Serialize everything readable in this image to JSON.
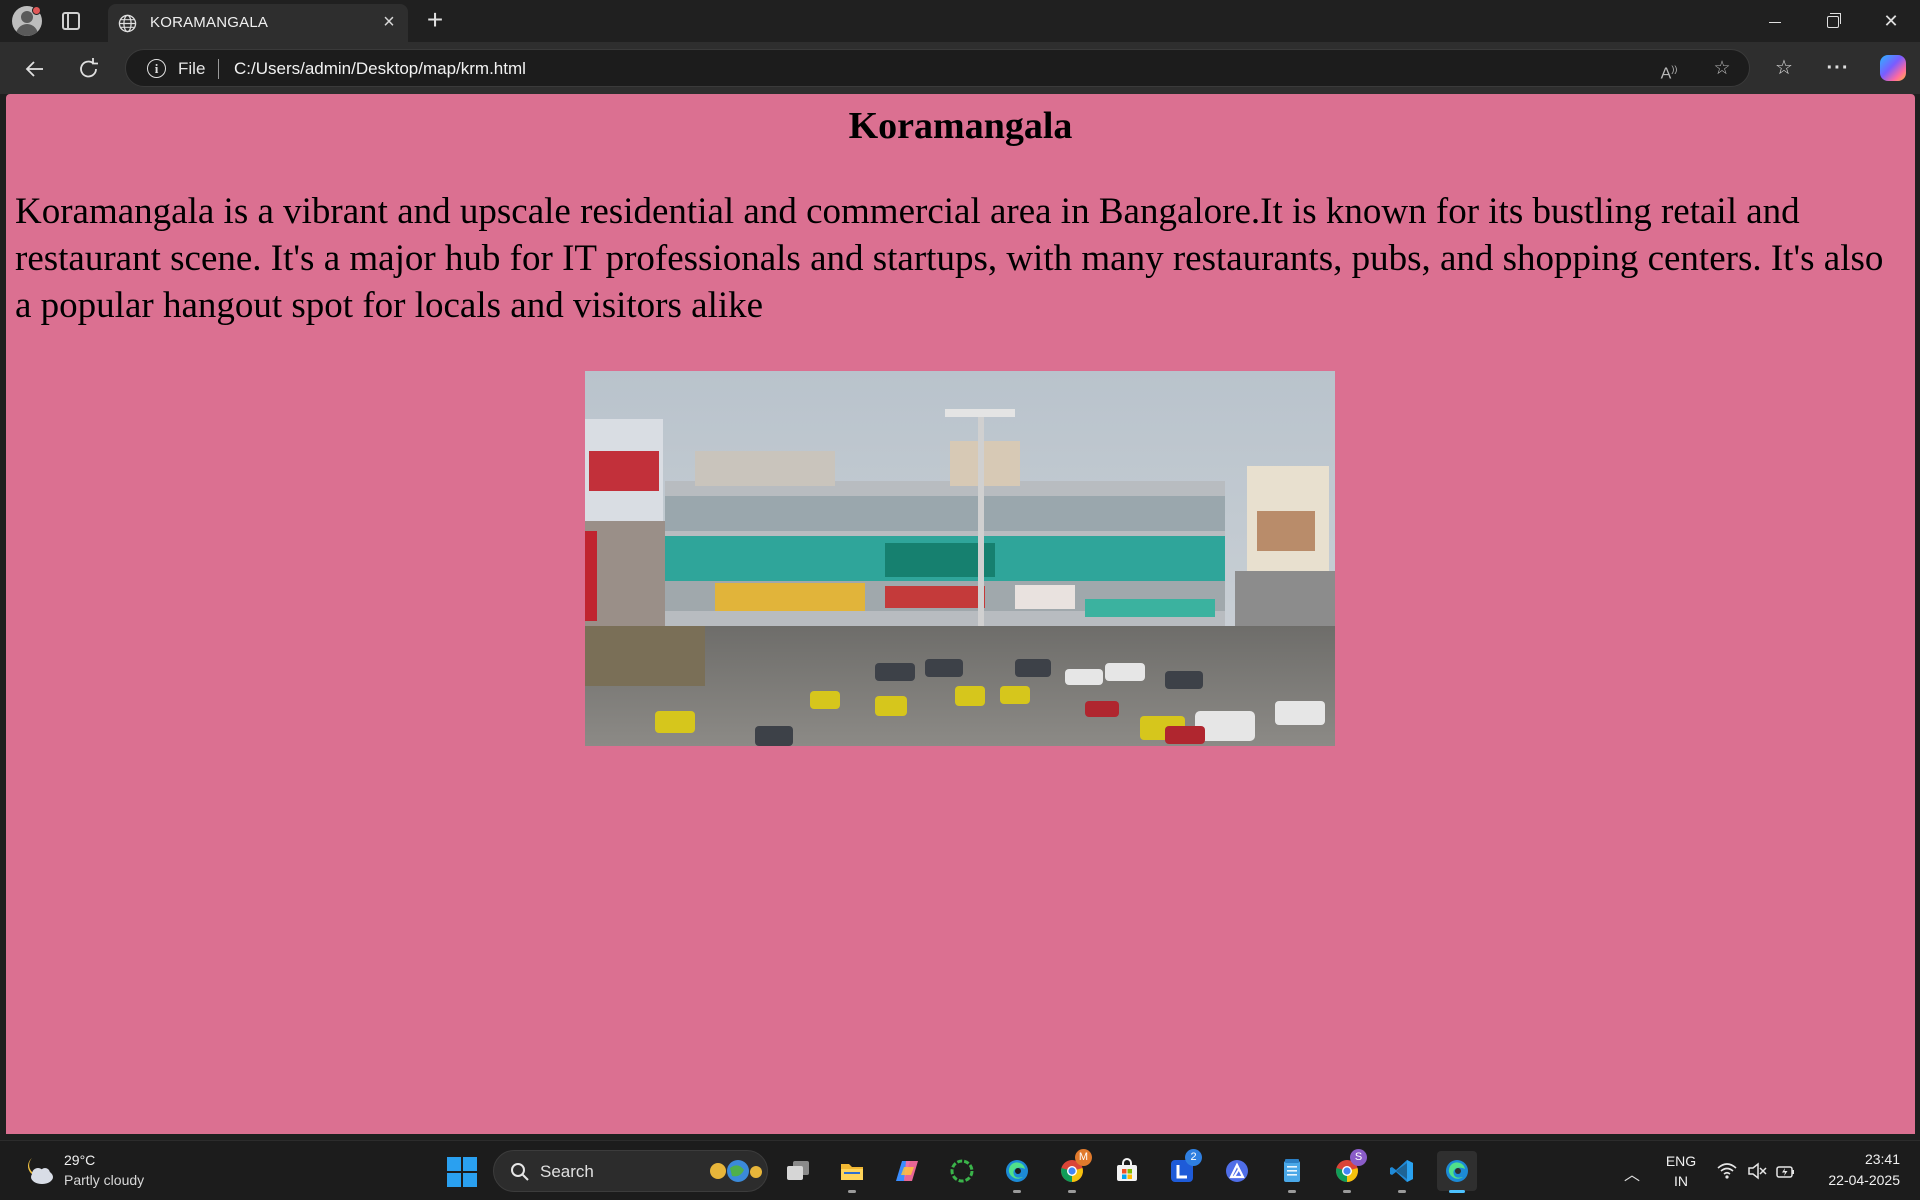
{
  "browser": {
    "tab_title": "KORAMANGALA",
    "tab_icon": "globe-icon",
    "address_prefix": "File",
    "url": "C:/Users/admin/Desktop/map/krm.html"
  },
  "page": {
    "background_color": "#db7091",
    "heading": "Koramangala",
    "paragraph": "Koramangala is a vibrant and upscale residential and commercial area in Bangalore.It is known for its bustling retail and restaurant scene. It's a major hub for IT professionals and startups, with many restaurants, pubs, and shopping centers. It's also a popular hangout spot for locals and visitors alike",
    "image_subject": "street-view photo of a shopping mall with traffic and billboards"
  },
  "taskbar": {
    "weather_temp": "29°C",
    "weather_desc": "Partly cloudy",
    "search_label": "Search",
    "apps": [
      {
        "name": "task-view",
        "icon": "task-view-icon"
      },
      {
        "name": "file-explorer",
        "icon": "folder-icon"
      },
      {
        "name": "copilot",
        "icon": "copilot-icon"
      },
      {
        "name": "circle-app",
        "icon": "green-ring-icon"
      },
      {
        "name": "edge",
        "icon": "edge-icon"
      },
      {
        "name": "chrome-profile-m",
        "icon": "chrome-icon",
        "badge": "M"
      },
      {
        "name": "microsoft-store",
        "icon": "store-icon"
      },
      {
        "name": "l-app",
        "icon": "l-app-icon",
        "badge": "2"
      },
      {
        "name": "triangle-app",
        "icon": "triangle-app-icon"
      },
      {
        "name": "notepad",
        "icon": "notepad-icon"
      },
      {
        "name": "chrome-profile-s",
        "icon": "chrome-icon",
        "badge": "S"
      },
      {
        "name": "vscode",
        "icon": "vscode-icon"
      },
      {
        "name": "edge-active",
        "icon": "edge-icon"
      }
    ],
    "lang_line1": "ENG",
    "lang_line2": "IN",
    "time": "23:41",
    "date": "22-04-2025"
  }
}
